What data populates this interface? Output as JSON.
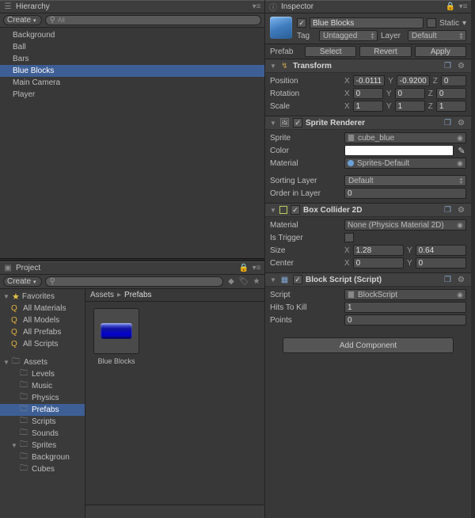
{
  "hierarchy": {
    "title": "Hierarchy",
    "create": "Create",
    "search_placeholder": "All",
    "items": [
      {
        "label": "Background",
        "selected": false
      },
      {
        "label": "Ball",
        "selected": false
      },
      {
        "label": "Bars",
        "selected": false
      },
      {
        "label": "Blue Blocks",
        "selected": true
      },
      {
        "label": "Main Camera",
        "selected": false
      },
      {
        "label": "Player",
        "selected": false
      }
    ]
  },
  "project": {
    "title": "Project",
    "create": "Create",
    "breadcrumb": [
      "Assets",
      "Prefabs"
    ],
    "tree": {
      "favorites": "Favorites",
      "fav_items": [
        "All Materials",
        "All Models",
        "All Prefabs",
        "All Scripts"
      ],
      "assets": "Assets",
      "asset_items": [
        {
          "label": "Levels"
        },
        {
          "label": "Music"
        },
        {
          "label": "Physics"
        },
        {
          "label": "Prefabs",
          "selected": true
        },
        {
          "label": "Scripts"
        },
        {
          "label": "Sounds"
        },
        {
          "label": "Sprites",
          "expanded": true,
          "children": [
            "Backgroun",
            "Cubes"
          ]
        }
      ]
    },
    "assets": [
      {
        "label": "Blue Blocks"
      }
    ]
  },
  "inspector": {
    "title": "Inspector",
    "object_name": "Blue Blocks",
    "static_label": "Static",
    "tag_label": "Tag",
    "tag_value": "Untagged",
    "layer_label": "Layer",
    "layer_value": "Default",
    "prefab_label": "Prefab",
    "prefab_buttons": [
      "Select",
      "Revert",
      "Apply"
    ],
    "components": {
      "transform": {
        "title": "Transform",
        "fields": {
          "position_label": "Position",
          "rotation_label": "Rotation",
          "scale_label": "Scale"
        },
        "position": {
          "x": "-0.0111",
          "y": "-0.9200",
          "z": "0"
        },
        "rotation": {
          "x": "0",
          "y": "0",
          "z": "0"
        },
        "scale": {
          "x": "1",
          "y": "1",
          "z": "1"
        }
      },
      "sprite_renderer": {
        "title": "Sprite Renderer",
        "sprite_label": "Sprite",
        "sprite_value": "cube_blue",
        "color_label": "Color",
        "color_value": "#FFFFFF",
        "material_label": "Material",
        "material_value": "Sprites-Default",
        "sorting_label": "Sorting Layer",
        "sorting_value": "Default",
        "order_label": "Order in Layer",
        "order_value": "0"
      },
      "box_collider": {
        "title": "Box Collider 2D",
        "material_label": "Material",
        "material_value": "None (Physics Material 2D)",
        "trigger_label": "Is Trigger",
        "trigger_value": false,
        "size_label": "Size",
        "size": {
          "x": "1.28",
          "y": "0.64"
        },
        "center_label": "Center",
        "center": {
          "x": "0",
          "y": "0"
        }
      },
      "block_script": {
        "title": "Block Script (Script)",
        "script_label": "Script",
        "script_value": "BlockScript",
        "hits_label": "Hits To Kill",
        "hits_value": "1",
        "points_label": "Points",
        "points_value": "0"
      }
    },
    "add_component": "Add Component"
  },
  "axis_labels": {
    "x": "X",
    "y": "Y",
    "z": "Z"
  }
}
